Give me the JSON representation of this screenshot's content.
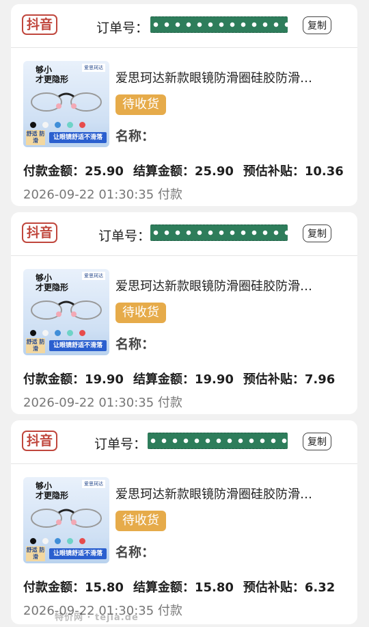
{
  "orders": [
    {
      "platform": "抖音",
      "order_label": "订单号：",
      "copy_label": "复制",
      "thumb": {
        "title": "够小\n才更隐形",
        "brand": "爱思珂达",
        "tag": "舒适 防滑",
        "banner": "让眼镜舒适不滑落"
      },
      "product_title": "爱思珂达新款眼镜防滑圈硅胶防滑…",
      "status": "待收货",
      "name_label": "名称：",
      "pay": "付款金额：25.90",
      "settle": "结算金额：25.90",
      "subsidy": "预估补贴：10.36",
      "time": "2026-09-22 01:30:35 付款"
    },
    {
      "platform": "抖音",
      "order_label": "订单号：",
      "copy_label": "复制",
      "thumb": {
        "title": "够小\n才更隐形",
        "brand": "爱思珂达",
        "tag": "舒适 防滑",
        "banner": "让眼镜舒适不滑落"
      },
      "product_title": "爱思珂达新款眼镜防滑圈硅胶防滑…",
      "status": "待收货",
      "name_label": "名称：",
      "pay": "付款金额：19.90",
      "settle": "结算金额：19.90",
      "subsidy": "预估补贴：7.96",
      "time": "2026-09-22 01:30:35 付款"
    },
    {
      "platform": "抖音",
      "order_label": "订单号：",
      "copy_label": "复制",
      "thumb": {
        "title": "够小\n才更隐形",
        "brand": "爱思珂达",
        "tag": "舒适 防滑",
        "banner": "让眼镜舒适不滑落"
      },
      "product_title": "爱思珂达新款眼镜防滑圈硅胶防滑…",
      "status": "待收货",
      "name_label": "名称：",
      "pay": "付款金额：15.80",
      "settle": "结算金额：15.80",
      "subsidy": "预估补贴：6.32",
      "time": "2026-09-22 01:30:35 付款"
    }
  ],
  "watermark": "特价网 · tejia.de",
  "colors": {
    "platform": "#c0463c",
    "status_bg": "#e6ab4a",
    "mask": "#2e7d5b",
    "thumb_banner": "#2a5fcf"
  }
}
